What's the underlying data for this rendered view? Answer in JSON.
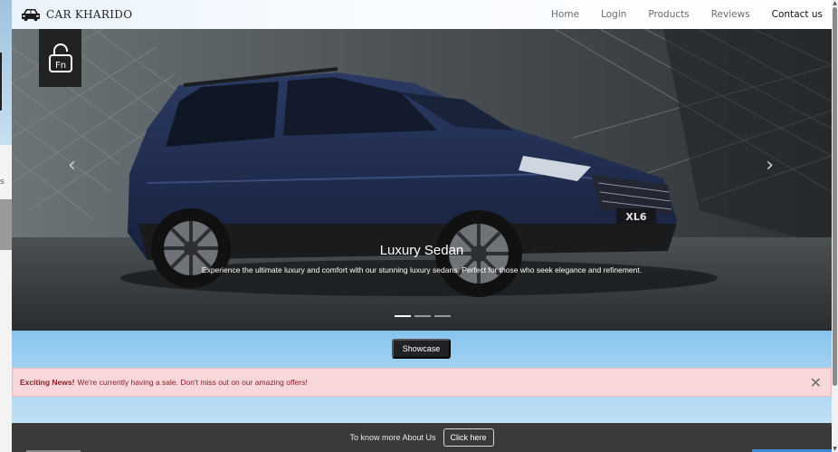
{
  "brand": {
    "name": "CAR KHARIDO",
    "logo_icon": "car-icon"
  },
  "nav": {
    "links": [
      {
        "label": "Home",
        "active": false
      },
      {
        "label": "Login",
        "active": false
      },
      {
        "label": "Products",
        "active": false
      },
      {
        "label": "Reviews",
        "active": false
      },
      {
        "label": "Contact us",
        "active": true
      }
    ]
  },
  "carousel": {
    "badge_icon": "fn-lock-icon",
    "badge_text": "Fn",
    "prev_icon": "chevron-left-icon",
    "next_icon": "chevron-right-icon",
    "prev_glyph": "‹",
    "next_glyph": "›",
    "vehicle_plate": "XL6",
    "caption": {
      "title": "Luxury Sedan",
      "text": "Experience the ultimate luxury and comfort with our stunning luxury sedans. Perfect for those who seek elegance and refinement."
    },
    "slide_count": 3,
    "active_slide": 1
  },
  "showcase": {
    "button_label": "Showcase"
  },
  "alert": {
    "strong": "Exciting News!",
    "text": "We're currently having a sale. Don't miss out on our amazing offers!",
    "close_icon": "close-icon",
    "close_glyph": "✕"
  },
  "footer": {
    "text": "To know more About Us",
    "button_label": "Click here"
  },
  "colors": {
    "nav_active": "#111111",
    "alert_bg": "#f8d7da",
    "alert_text": "#842029",
    "showcase_bg": "#87c4ee",
    "footer_bg": "#3a3a3a",
    "car_body": "#1e2a4a"
  },
  "left_strip": {
    "fragment": "s"
  },
  "scrollbar": {
    "up_glyph": "▲",
    "down_glyph": "▼"
  }
}
